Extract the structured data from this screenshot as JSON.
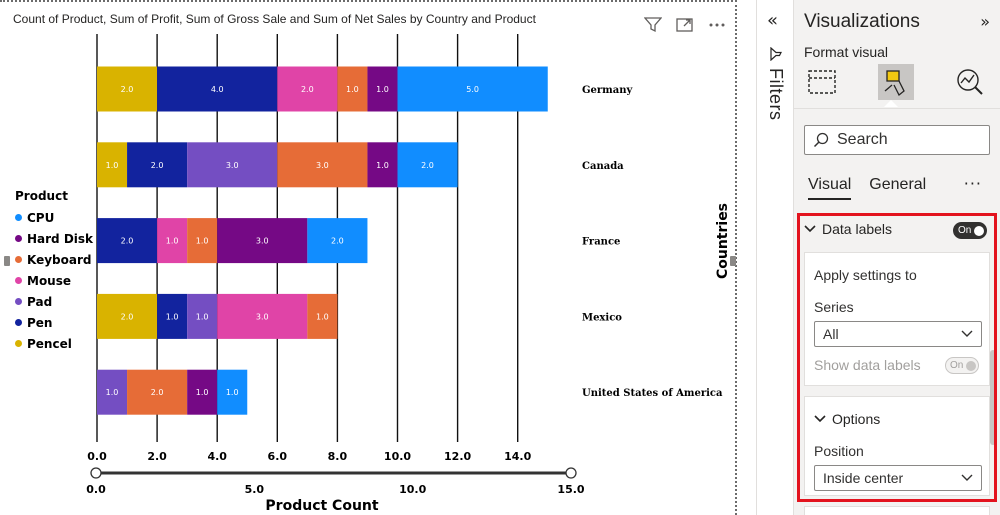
{
  "visual": {
    "title": "Count of Product, Sum of Profit, Sum of Gross Sale and Sum of Net Sales by Country and Product",
    "icons": [
      "filter-icon",
      "focus-mode-icon",
      "more-options-icon"
    ]
  },
  "chart_data": {
    "type": "bar",
    "orientation": "horizontal",
    "stacked": true,
    "xlabel": "Product Count",
    "ylabel": "Countries",
    "xlim": [
      0,
      15
    ],
    "xticks": [
      "0.0",
      "2.0",
      "4.0",
      "6.0",
      "8.0",
      "10.0",
      "12.0",
      "14.0"
    ],
    "grid": true,
    "legend_title": "Product",
    "legend_position": "left",
    "legend": [
      {
        "name": "CPU",
        "color": "#118dff"
      },
      {
        "name": "Hard Disk",
        "color": "#750985"
      },
      {
        "name": "Keyboard",
        "color": "#e66c37"
      },
      {
        "name": "Mouse",
        "color": "#e044a7"
      },
      {
        "name": "Pad",
        "color": "#744ec2"
      },
      {
        "name": "Pen",
        "color": "#12239e"
      },
      {
        "name": "Pencel",
        "color": "#d9b300"
      }
    ],
    "categories": [
      "Germany",
      "Canada",
      "France",
      "Mexico",
      "United States of America"
    ],
    "bars": [
      {
        "category": "Germany",
        "segments": [
          {
            "product": "Pencel",
            "value": 2.0,
            "label": "2.0"
          },
          {
            "product": "Pen",
            "value": 4.0,
            "label": "4.0"
          },
          {
            "product": "Mouse",
            "value": 2.0,
            "label": "2.0"
          },
          {
            "product": "Keyboard",
            "value": 1.0,
            "label": "1.0"
          },
          {
            "product": "Hard Disk",
            "value": 1.0,
            "label": "1.0"
          },
          {
            "product": "CPU",
            "value": 5.0,
            "label": "5.0"
          }
        ]
      },
      {
        "category": "Canada",
        "segments": [
          {
            "product": "Pencel",
            "value": 1.0,
            "label": "1.0"
          },
          {
            "product": "Pen",
            "value": 2.0,
            "label": "2.0"
          },
          {
            "product": "Pad",
            "value": 3.0,
            "label": "3.0"
          },
          {
            "product": "Keyboard",
            "value": 3.0,
            "label": "3.0"
          },
          {
            "product": "Hard Disk",
            "value": 1.0,
            "label": "1.0"
          },
          {
            "product": "CPU",
            "value": 2.0,
            "label": "2.0"
          }
        ]
      },
      {
        "category": "France",
        "segments": [
          {
            "product": "Pen",
            "value": 2.0,
            "label": "2.0"
          },
          {
            "product": "Mouse",
            "value": 1.0,
            "label": "1.0"
          },
          {
            "product": "Keyboard",
            "value": 1.0,
            "label": "1.0"
          },
          {
            "product": "Hard Disk",
            "value": 3.0,
            "label": "3.0"
          },
          {
            "product": "CPU",
            "value": 2.0,
            "label": "2.0"
          }
        ]
      },
      {
        "category": "Mexico",
        "segments": [
          {
            "product": "Pencel",
            "value": 2.0,
            "label": "2.0"
          },
          {
            "product": "Pen",
            "value": 1.0,
            "label": "1.0"
          },
          {
            "product": "Pad",
            "value": 1.0,
            "label": "1.0"
          },
          {
            "product": "Mouse",
            "value": 3.0,
            "label": "3.0"
          },
          {
            "product": "Keyboard",
            "value": 1.0,
            "label": "1.0"
          }
        ]
      },
      {
        "category": "United States of America",
        "segments": [
          {
            "product": "Pad",
            "value": 1.0,
            "label": "1.0"
          },
          {
            "product": "Keyboard",
            "value": 2.0,
            "label": "2.0"
          },
          {
            "product": "Hard Disk",
            "value": 1.0,
            "label": "1.0"
          },
          {
            "product": "CPU",
            "value": 1.0,
            "label": "1.0"
          }
        ]
      }
    ],
    "zoom_slider": {
      "range": [
        0,
        15
      ],
      "ticks": [
        "0.0",
        "5.0",
        "10.0",
        "15.0"
      ],
      "start": 0,
      "end": 15
    }
  },
  "filters_pane": {
    "label": "Filters",
    "collapse_icon": "chevron-double-left-icon"
  },
  "viz_pane": {
    "title": "Visualizations",
    "subtitle": "Format visual",
    "search_placeholder": "Search",
    "tabs": [
      {
        "label": "Visual",
        "active": true
      },
      {
        "label": "General",
        "active": false
      }
    ],
    "more": "···",
    "data_labels": {
      "label": "Data labels",
      "toggle": "On",
      "apply_settings": "Apply settings to",
      "series_label": "Series",
      "series_value": "All",
      "show_label": "Show data labels",
      "show_toggle": "On"
    },
    "options": {
      "label": "Options",
      "position_label": "Position",
      "position_value": "Inside center"
    }
  }
}
